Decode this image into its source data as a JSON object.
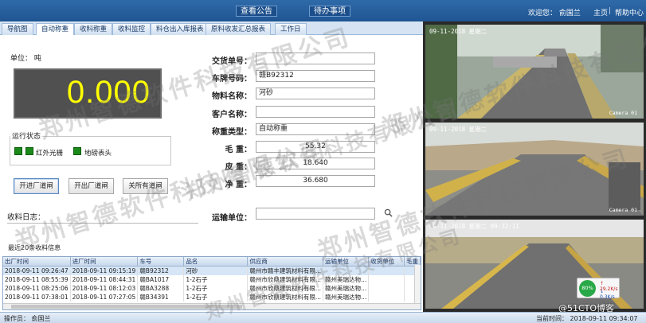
{
  "header": {
    "notice_label": "查看公告",
    "todo_label": "待办事项",
    "welcome": "欢迎您：  俞国兰",
    "home_label": "主页",
    "separator": "|",
    "help_label": "帮助中心"
  },
  "tabs": [
    {
      "label": "导航图"
    },
    {
      "label": "自动称重"
    },
    {
      "label": "收料称重"
    },
    {
      "label": "收料监控"
    },
    {
      "label": "料仓出入库报表"
    },
    {
      "label": "原料收发汇总报表"
    },
    {
      "label": "工作日"
    }
  ],
  "weighing": {
    "unit_text": "单位：  吨",
    "display_value": "0.000",
    "display_color": "#ffff00"
  },
  "status": {
    "title": "运行状态",
    "items": [
      {
        "label": "红外光栅",
        "color": "#1b8a1b"
      },
      {
        "label": "地磅表头",
        "color": "#1b8a1b"
      }
    ]
  },
  "buttons": {
    "open_in": "开进厂道闸",
    "open_out": "开出厂道闸",
    "close_all": "关所有道闸"
  },
  "form": {
    "delivery_no_label": "交货单号：",
    "delivery_no_value": "",
    "plate_label": "车牌号码：",
    "plate_value": "赣B92312",
    "material_label": "物料名称：",
    "material_value": "河砂",
    "customer_label": "客户名称：",
    "customer_value": "",
    "weigh_type_label": "称重类型：",
    "weigh_type_value": "自动称重",
    "gross_label": "毛    重：",
    "gross_value": "55.32",
    "tare_label": "皮    重：",
    "tare_value": "18.640",
    "net_label": "净    重：",
    "net_value": "36.680",
    "carrier_label": "运输单位：",
    "carrier_value": ""
  },
  "log": {
    "label": "收料日志："
  },
  "recent": {
    "title": "最近20条收料信息",
    "columns": [
      "出厂时间",
      "进厂时间",
      "车号",
      "品名",
      "供应商",
      "运输单位",
      "收货单位",
      "毛重"
    ],
    "rows": [
      [
        "2018-09-11 09:26:47",
        "2018-09-11 09:15:19",
        "赣B92312",
        "河砂",
        "赣州市赣丰建筑材料有限...",
        "",
        "",
        ""
      ],
      [
        "2018-09-11 08:55:39",
        "2018-09-11 08:44:31",
        "赣BA1017",
        "1-2石子",
        "赣州市欣鼎建筑材料有限...",
        "赣州美瑞达物...",
        "",
        ""
      ],
      [
        "2018-09-11 08:25:06",
        "2018-09-11 08:12:03",
        "赣BA3288",
        "1-2石子",
        "赣州市欣鼎建筑材料有限...",
        "赣州美瑞达物...",
        "",
        ""
      ],
      [
        "2018-09-11 07:38:01",
        "2018-09-11 07:27:05",
        "赣B34391",
        "1-2石子",
        "赣州市欣鼎建筑材料有限...",
        "赣州美瑞达物...",
        "",
        ""
      ]
    ]
  },
  "cameras": [
    {
      "timestamp": "09-11-2018 星期二",
      "label": "Camera 01"
    },
    {
      "timestamp": "09-11-2018 星期二",
      "label": "Camera 01"
    },
    {
      "timestamp": "09-11-2018  星期二  09:32:11",
      "label": ""
    }
  ],
  "statusbar": {
    "operator": "操作员：  俞国兰",
    "current_time": "当前时间：  2018-09-11 09:34:07"
  },
  "net_widget": {
    "percent": "80%",
    "up": "↑ 29.2K/s",
    "down": "↓ 0.3K/s"
  },
  "brand_watermark": "@51CTO博客",
  "watermark_text": "郑州智德软件科技有限公司"
}
